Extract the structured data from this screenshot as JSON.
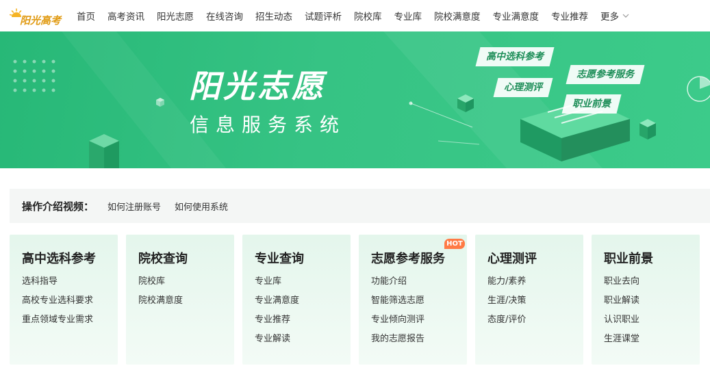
{
  "logo": {
    "text": "阳光高考",
    "color": "#e09a12"
  },
  "nav": {
    "items": [
      "首页",
      "高考资讯",
      "阳光志愿",
      "在线咨询",
      "招生动态",
      "试题评析",
      "院校库",
      "专业库",
      "院校满意度",
      "专业满意度",
      "专业推荐"
    ],
    "more_label": "更多"
  },
  "banner": {
    "title": "阳光志愿",
    "subtitle": "信息服务系统",
    "tags": [
      "高中选科参考",
      "志愿参考服务",
      "心理测评",
      "职业前景"
    ],
    "color": "#36c384"
  },
  "intro": {
    "label": "操作介绍视频：",
    "links": [
      "如何注册账号",
      "如何使用系统"
    ]
  },
  "cards": [
    {
      "title": "高中选科参考",
      "links": [
        "选科指导",
        "高校专业选科要求",
        "重点领域专业需求"
      ]
    },
    {
      "title": "院校查询",
      "links": [
        "院校库",
        "院校满意度"
      ]
    },
    {
      "title": "专业查询",
      "links": [
        "专业库",
        "专业满意度",
        "专业推荐",
        "专业解读"
      ]
    },
    {
      "title": "志愿参考服务",
      "badge": "HOT",
      "links": [
        "功能介绍",
        "智能筛选志愿",
        "专业倾向测评",
        "我的志愿报告"
      ]
    },
    {
      "title": "心理测评",
      "links": [
        "能力/素养",
        "生涯/决策",
        "态度/评价"
      ]
    },
    {
      "title": "职业前景",
      "links": [
        "职业去向",
        "职业解读",
        "认识职业",
        "生涯课堂"
      ]
    }
  ]
}
